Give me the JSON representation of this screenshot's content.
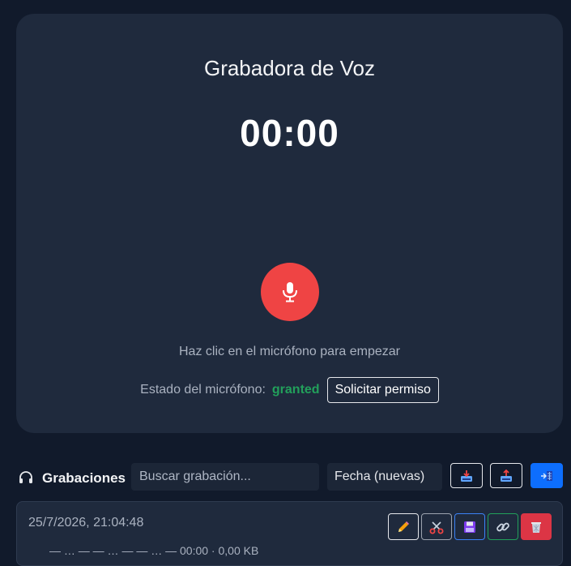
{
  "recorder": {
    "title": "Grabadora de Voz",
    "timer": "00:00",
    "hint": "Haz clic en el micrófono para empezar",
    "permission_label": "Estado del micrófono:",
    "permission_status": "granted",
    "permission_button": "Solicitar permiso",
    "mic_icon": "microphone-icon"
  },
  "recordings": {
    "header_icon": "headphones-icon",
    "title": "Grabaciones",
    "search_placeholder": "Buscar grabación...",
    "sort_selected": "Fecha (nuevas)",
    "items": [
      {
        "date": "25/7/2026, 21:04:48",
        "subline": "— … — — … — — … — 00:00 · 0,00 KB",
        "actions": [
          "pencil-icon",
          "scissors-icon",
          "floppy-disk-icon",
          "link-icon",
          "wastebasket-icon"
        ]
      }
    ]
  },
  "colors": {
    "background": "#111a2b",
    "card": "#1f2a3d",
    "mic_button": "#ef4444",
    "status_ok": "#22a05b",
    "primary": "#0d6efd",
    "danger": "#dc3545"
  }
}
